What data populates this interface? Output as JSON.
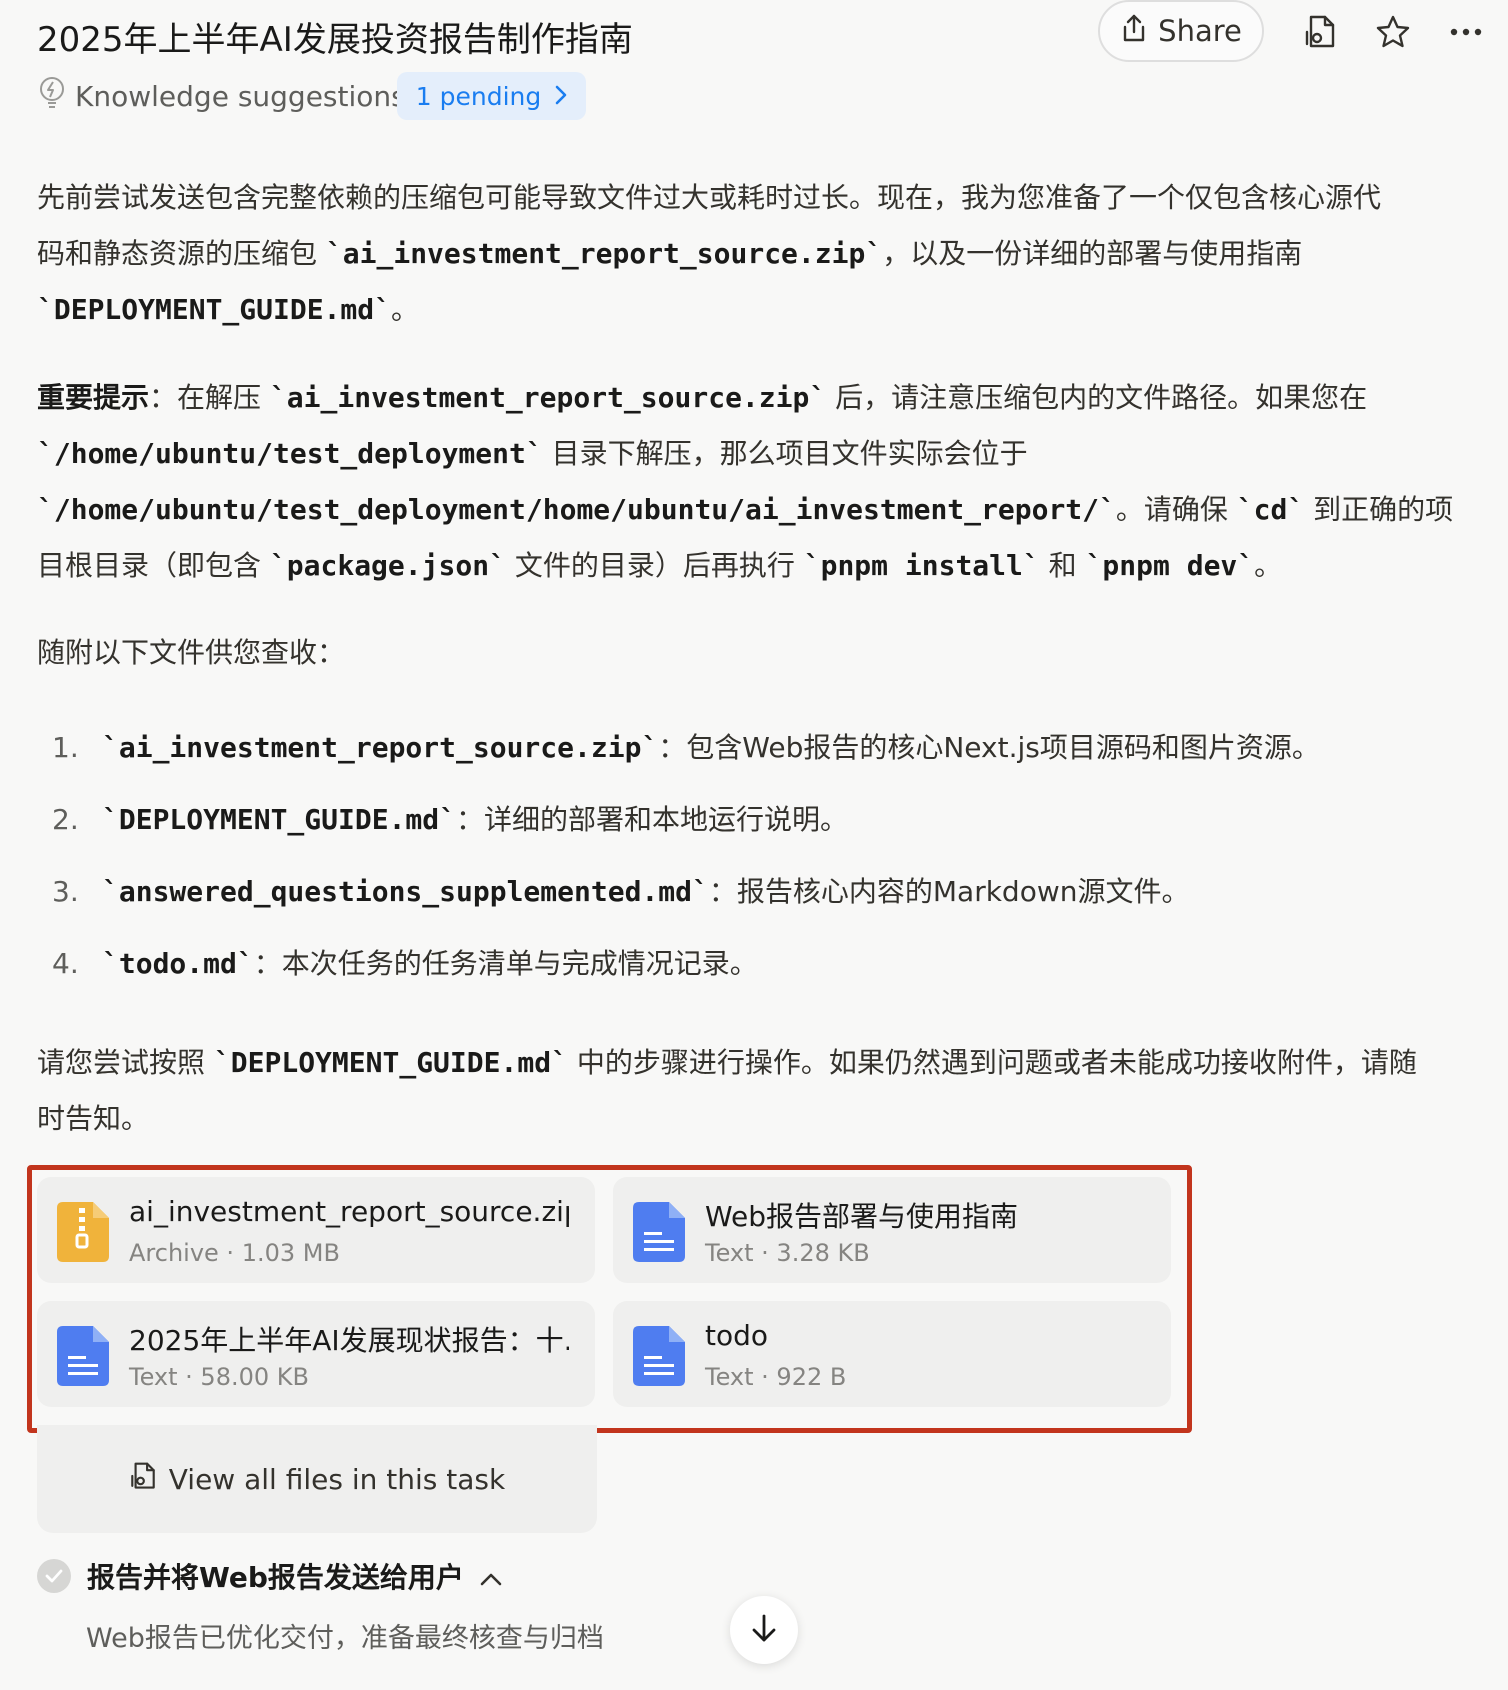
{
  "header": {
    "title": "2025年上半年AI发展投资报告制作指南",
    "share_label": "Share"
  },
  "knowledge": {
    "label": "Knowledge suggestions",
    "pending_label": "1 pending"
  },
  "message": {
    "p1": {
      "l1": "先前尝试发送包含完整依赖的压缩包可能导致文件过大或耗时过长。现在，我为您准备了一个仅包含核心源代",
      "l2_a": "码和静态资源的压缩包 ",
      "l2_code": "`ai_investment_report_source.zip`",
      "l2_b": "，以及一份详细的部署与使用指南",
      "l3_code": "`DEPLOYMENT_GUIDE.md`",
      "l3_b": "。"
    },
    "p2": {
      "bold": "重要提示",
      "a": "：在解压 ",
      "code1": "`ai_investment_report_source.zip`",
      "b": " 后，请注意压缩包内的文件路径。如果您在",
      "code2": "`/home/ubuntu/test_deployment`",
      "c": " 目录下解压，那么项目文件实际会位于",
      "code3": "`/home/ubuntu/test_deployment/home/ubuntu/ai_investment_report/`",
      "d": "。请确保 ",
      "code4": "`cd`",
      "e": " 到正确的项",
      "f": "目根目录（即包含 ",
      "code5": "`package.json`",
      "g": " 文件的目录）后再执行 ",
      "code6": "`pnpm install`",
      "h": " 和 ",
      "code7": "`pnpm dev`",
      "i": "。"
    },
    "p3": "随附以下文件供您查收：",
    "list": [
      {
        "num": "1.",
        "code": "`ai_investment_report_source.zip`",
        "text": "：包含Web报告的核心Next.js项目源码和图片资源。"
      },
      {
        "num": "2.",
        "code": "`DEPLOYMENT_GUIDE.md`",
        "text": "：详细的部署和本地运行说明。"
      },
      {
        "num": "3.",
        "code": "`answered_questions_supplemented.md`",
        "text": "：报告核心内容的Markdown源文件。"
      },
      {
        "num": "4.",
        "code": "`todo.md`",
        "text": "：本次任务的任务清单与完成情况记录。"
      }
    ],
    "p4": {
      "a": "请您尝试按照 ",
      "code": "`DEPLOYMENT_GUIDE.md`",
      "b": " 中的步骤进行操作。如果仍然遇到问题或者未能成功接收附件，请随",
      "c": "时告知。"
    }
  },
  "files": [
    {
      "name": "ai_investment_report_source.zip",
      "meta": "Archive · 1.03 MB",
      "icon": "zip-file-icon",
      "color": "#f0b33b"
    },
    {
      "name": "Web报告部署与使用指南",
      "meta": "Text · 3.28 KB",
      "icon": "text-file-icon",
      "color": "#4f7df0"
    },
    {
      "name": "2025年上半年AI发展现状报告：十...",
      "meta": "Text · 58.00 KB",
      "icon": "text-file-icon",
      "color": "#4f7df0"
    },
    {
      "name": "todo",
      "meta": "Text · 922 B",
      "icon": "text-file-icon",
      "color": "#4f7df0"
    }
  ],
  "view_all_label": "View all files in this task",
  "step": {
    "title": "报告并将Web报告发送给用户",
    "subtitle": "Web报告已优化交付，准备最终核查与归档"
  },
  "colors": {
    "highlight_frame": "#c2351d",
    "pending_bg": "#e4eefb",
    "pending_text": "#1a7df0"
  }
}
